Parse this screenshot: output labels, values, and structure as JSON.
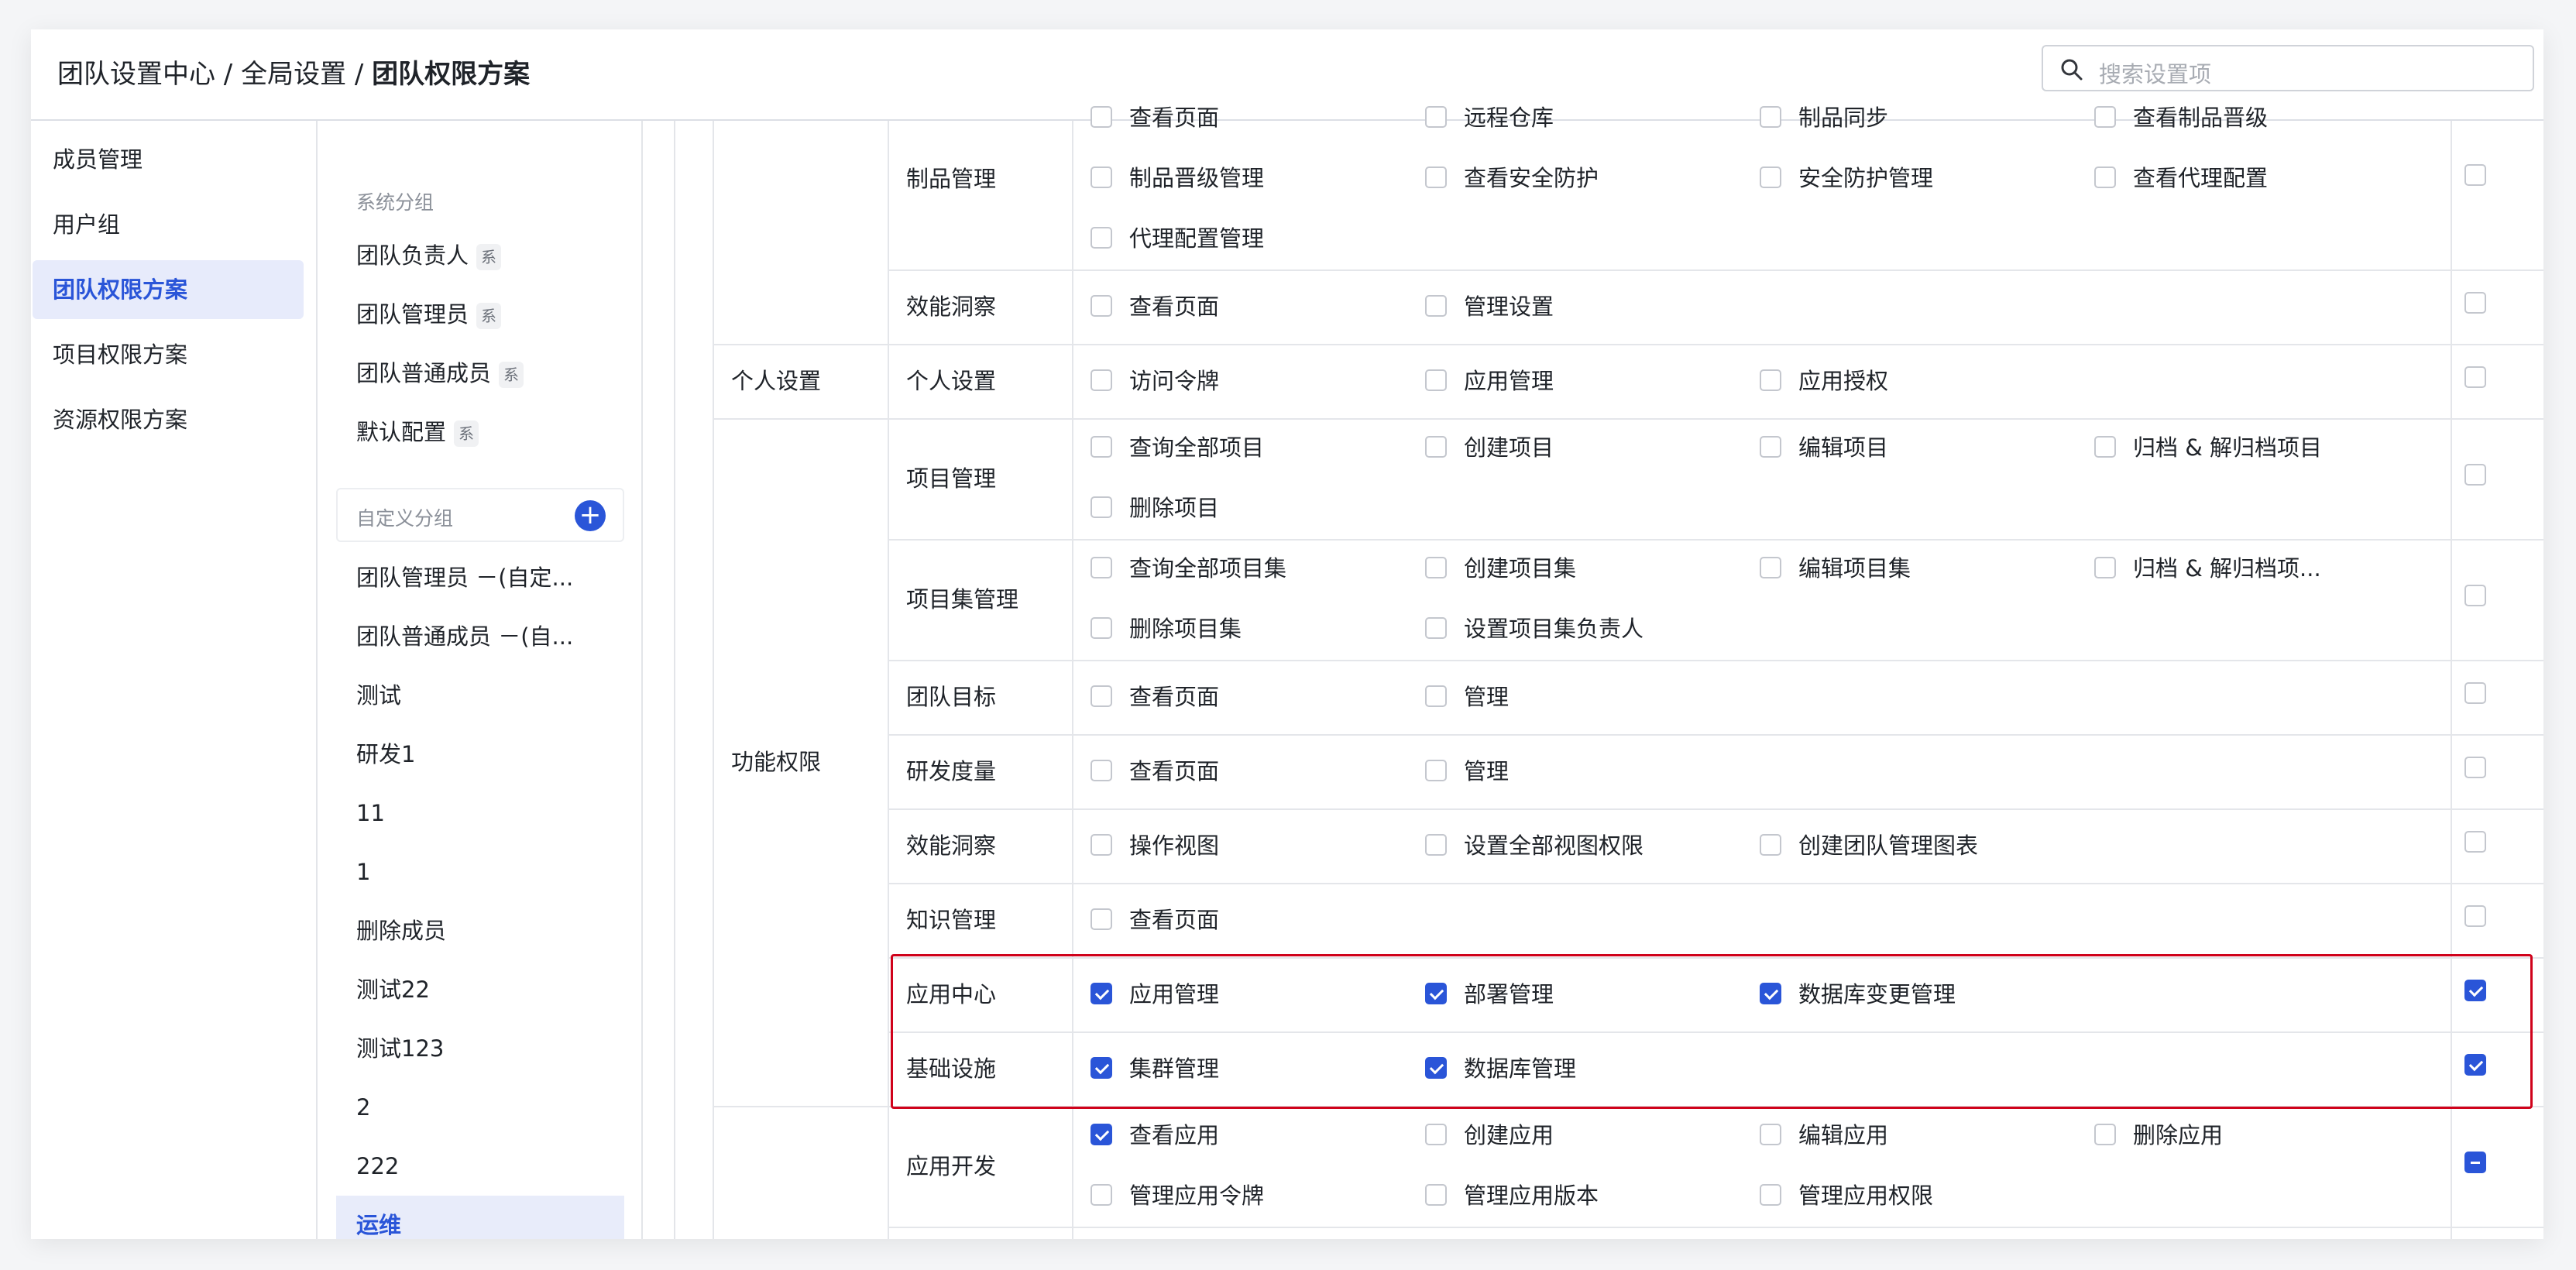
{
  "header": {
    "breadcrumb": [
      "团队设置中心",
      "全局设置",
      "团队权限方案"
    ],
    "separator": " / ",
    "search_placeholder": "搜索设置项"
  },
  "sidebar": {
    "items": [
      "成员管理",
      "用户组",
      "团队权限方案",
      "项目权限方案",
      "资源权限方案"
    ],
    "active_index": 2
  },
  "groups": {
    "system_label": "系统分组",
    "system_tag": "系",
    "system": [
      "团队负责人",
      "团队管理员",
      "团队普通成员",
      "默认配置"
    ],
    "custom_label": "自定义分组",
    "custom": [
      "团队管理员 －(自定...",
      "团队普通成员 －(自...",
      "测试",
      "研发1",
      "11",
      "1",
      "删除成员",
      "测试22",
      "测试123",
      "2",
      "222",
      "运维"
    ],
    "active": "运维"
  },
  "permissions": {
    "categories": [
      "个人设置",
      "功能权限"
    ],
    "rows": [
      {
        "label": "制品管理",
        "perms": [
          [
            "查看页面",
            false
          ],
          [
            "远程仓库",
            false
          ],
          [
            "制品同步",
            false
          ],
          [
            "查看制品晋级",
            false
          ],
          [
            "制品晋级管理",
            false
          ],
          [
            "查看安全防护",
            false
          ],
          [
            "安全防护管理",
            false
          ],
          [
            "查看代理配置",
            false
          ],
          [
            "代理配置管理",
            false
          ]
        ],
        "all": "none"
      },
      {
        "label": "效能洞察",
        "perms": [
          [
            "查看页面",
            false
          ],
          [
            "管理设置",
            false
          ]
        ],
        "all": "none"
      },
      {
        "label": "个人设置",
        "perms": [
          [
            "访问令牌",
            false
          ],
          [
            "应用管理",
            false
          ],
          [
            "应用授权",
            false
          ]
        ],
        "all": "none"
      },
      {
        "label": "项目管理",
        "perms": [
          [
            "查询全部项目",
            false
          ],
          [
            "创建项目",
            false
          ],
          [
            "编辑项目",
            false
          ],
          [
            "归档 & 解归档项目",
            false
          ],
          [
            "删除项目",
            false
          ]
        ],
        "all": "none"
      },
      {
        "label": "项目集管理",
        "perms": [
          [
            "查询全部项目集",
            false
          ],
          [
            "创建项目集",
            false
          ],
          [
            "编辑项目集",
            false
          ],
          [
            "归档 & 解归档项...",
            false
          ],
          [
            "删除项目集",
            false
          ],
          [
            "设置项目集负责人",
            false
          ]
        ],
        "all": "none"
      },
      {
        "label": "团队目标",
        "perms": [
          [
            "查看页面",
            false
          ],
          [
            "管理",
            false
          ]
        ],
        "all": "none"
      },
      {
        "label": "研发度量",
        "perms": [
          [
            "查看页面",
            false
          ],
          [
            "管理",
            false
          ]
        ],
        "all": "none"
      },
      {
        "label": "效能洞察",
        "perms": [
          [
            "操作视图",
            false
          ],
          [
            "设置全部视图权限",
            false
          ],
          [
            "创建团队管理图表",
            false
          ]
        ],
        "all": "none"
      },
      {
        "label": "知识管理",
        "perms": [
          [
            "查看页面",
            false
          ]
        ],
        "all": "none"
      },
      {
        "label": "应用中心",
        "perms": [
          [
            "应用管理",
            true
          ],
          [
            "部署管理",
            true
          ],
          [
            "数据库变更管理",
            true
          ]
        ],
        "all": "all"
      },
      {
        "label": "基础设施",
        "perms": [
          [
            "集群管理",
            true
          ],
          [
            "数据库管理",
            true
          ]
        ],
        "all": "all"
      },
      {
        "label": "应用开发",
        "perms": [
          [
            "查看应用",
            true
          ],
          [
            "创建应用",
            false
          ],
          [
            "编辑应用",
            false
          ],
          [
            "删除应用",
            false
          ],
          [
            "管理应用令牌",
            false
          ],
          [
            "管理应用版本",
            false
          ],
          [
            "管理应用权限",
            false
          ]
        ],
        "all": "partial"
      }
    ]
  },
  "colors": {
    "accent": "#2a55d8",
    "highlight_border": "#d0021b"
  }
}
